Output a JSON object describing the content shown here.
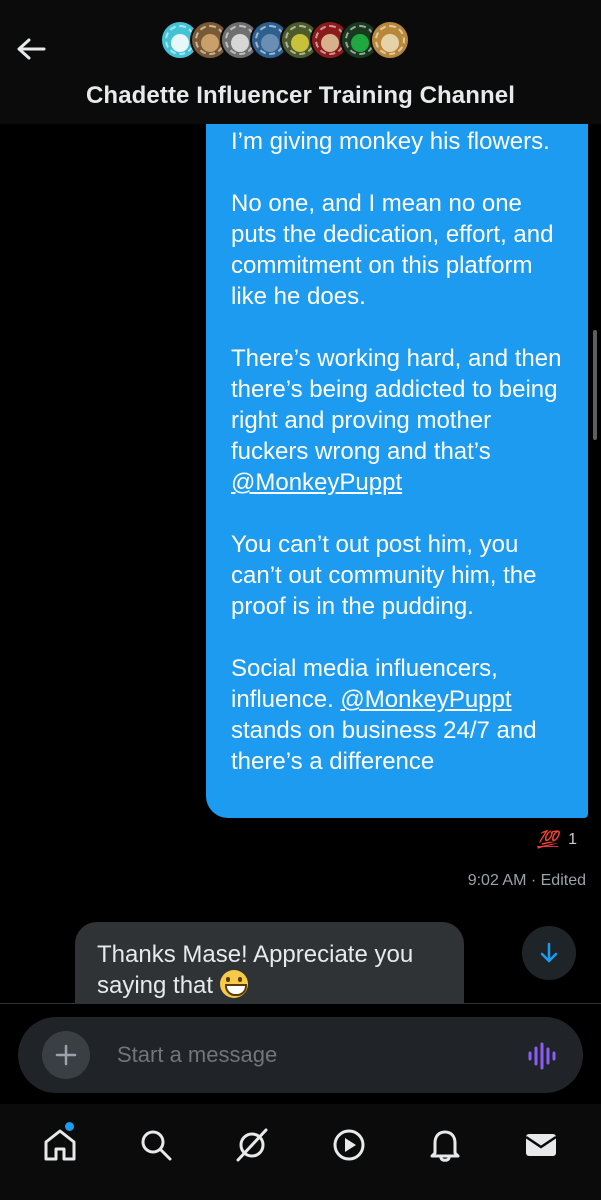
{
  "header": {
    "title": "Chadette Influencer Training Channel",
    "avatar_colors": [
      "#44c3d7",
      "#7a5a34",
      "#8c8c8c",
      "#2d5f8f",
      "#4d5a2a",
      "#8a1c1c",
      "#1fa83f",
      "#b8873a"
    ]
  },
  "messages": {
    "outgoing_paragraphs": [
      "I’m giving monkey his flowers.",
      "No one, and I mean no one puts the dedication, effort, and commitment on this platform like he does.",
      "There’s working hard, and then there’s being addicted to being right and proving mother fuckers wrong and that’s",
      "You can’t out post him, you can’t out community him, the proof is in the pudding.",
      "Social media influencers, influence.",
      "stands on business 24/7 and there’s a difference"
    ],
    "mention": "@MonkeyPuppt",
    "reaction": {
      "emoji": "💯",
      "count": "1"
    },
    "timestamp": "9:02 AM · Edited",
    "incoming_text": "Thanks Mase! Appreciate you saying that"
  },
  "composer": {
    "placeholder": "Start a message"
  },
  "colors": {
    "accent": "#1d9bf0",
    "voice": "#8b5cf6",
    "reaction": "#e0245e"
  },
  "icons": {
    "back": "arrow-left-icon",
    "scroll": "arrow-down-icon",
    "plus": "plus-icon",
    "voice": "voice-waveform-icon",
    "nav": [
      "home-icon",
      "search-icon",
      "grok-icon",
      "play-icon",
      "bell-icon",
      "mail-icon"
    ]
  }
}
